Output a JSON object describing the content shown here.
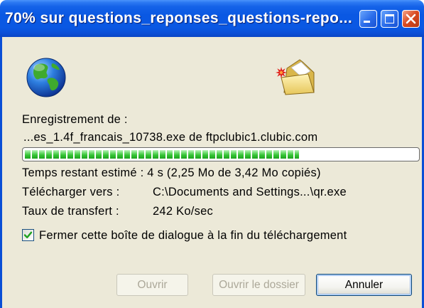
{
  "window": {
    "title": "70% sur questions_reponses_questions-repo...",
    "controls": {
      "minimize": "minimize-icon",
      "maximize": "maximize-icon",
      "close": "close-icon"
    }
  },
  "icons": {
    "source": "globe-icon",
    "destination": "folder-icon"
  },
  "download": {
    "saving_label": "Enregistrement de :",
    "source": "...es_1.4f_francais_10738.exe de ftpclubic1.clubic.com",
    "progress": 0.7,
    "time_remaining": "Temps restant estimé : 4 s (2,25 Mo de 3,42 Mo copiés)",
    "destination_label": "Télécharger vers :",
    "destination_value": "C:\\Documents and Settings...\\qr.exe",
    "rate_label": "Taux de transfert :",
    "rate_value": "242 Ko/sec"
  },
  "close_on_complete": {
    "checked": true,
    "label": "Fermer cette boîte de dialogue à la fin du téléchargement"
  },
  "buttons": {
    "open": {
      "label": "Ouvrir",
      "enabled": false
    },
    "open_folder": {
      "label": "Ouvrir le dossier",
      "enabled": false
    },
    "cancel": {
      "label": "Annuler",
      "enabled": true,
      "default": true
    }
  },
  "colors": {
    "title_bar": "#0A58E3",
    "close_button": "#D8481F",
    "progress_fill": "#33C333",
    "window_body": "#ECE9D8"
  }
}
